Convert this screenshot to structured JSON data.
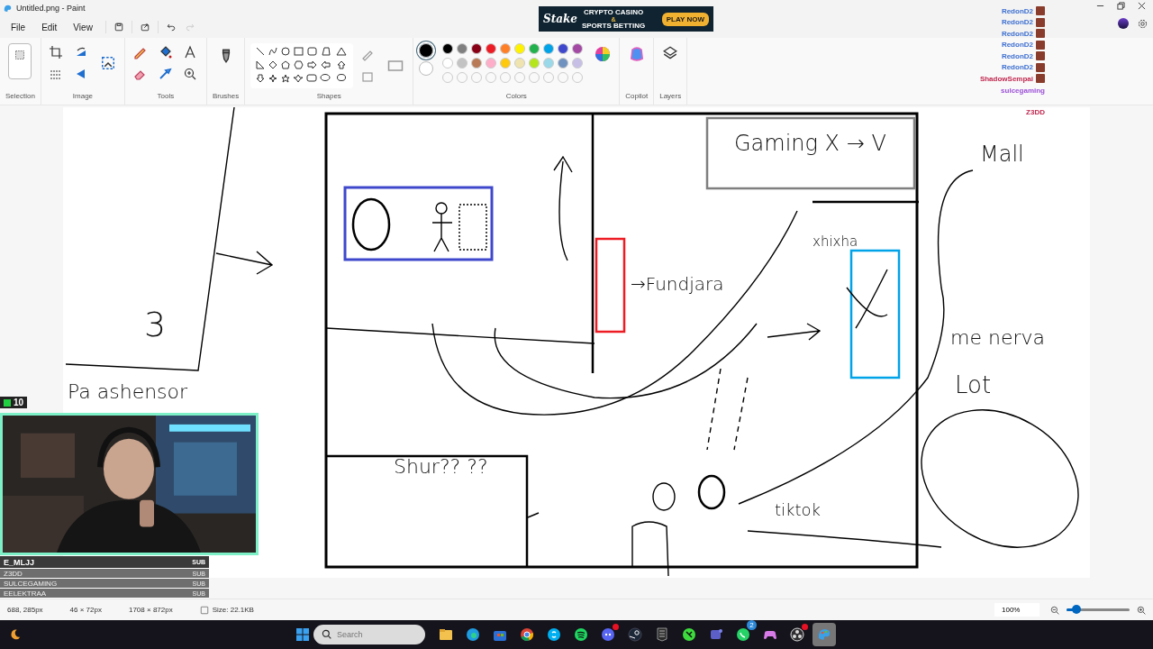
{
  "window": {
    "title": "Untitled.png - Paint"
  },
  "menu": [
    {
      "label": "File"
    },
    {
      "label": "Edit"
    },
    {
      "label": "View"
    }
  ],
  "redo": {
    "disabled": true
  },
  "ad": {
    "logo": "Stake",
    "line_1": "CRYPTO CASINO",
    "connector": "&",
    "line_2": "SPORTS BETTING",
    "button": "PLAY NOW"
  },
  "ribbon": {
    "groups": [
      {
        "label": "Selection"
      },
      {
        "label": "Image"
      },
      {
        "label": "Tools"
      },
      {
        "label": "Brushes"
      },
      {
        "label": "Shapes"
      },
      {
        "label": "Colors"
      },
      {
        "label": "Copilot"
      },
      {
        "label": "Layers"
      }
    ]
  },
  "colors": {
    "current": [
      {
        "color": "#000000",
        "selected": true
      },
      {
        "color": "#ffffff",
        "selected": false
      }
    ],
    "palette": [
      {
        "kind": "swatch",
        "color": "#000000"
      },
      {
        "kind": "swatch",
        "color": "#7f7f7f"
      },
      {
        "kind": "swatch",
        "color": "#880015"
      },
      {
        "kind": "swatch",
        "color": "#ed1c24"
      },
      {
        "kind": "swatch",
        "color": "#ff7f27"
      },
      {
        "kind": "swatch",
        "color": "#fff200"
      },
      {
        "kind": "swatch",
        "color": "#22b14c"
      },
      {
        "kind": "swatch",
        "color": "#00a2e8"
      },
      {
        "kind": "swatch",
        "color": "#3f48cc"
      },
      {
        "kind": "swatch",
        "color": "#a349a4"
      },
      {
        "kind": "swatch",
        "color": "#ffffff"
      },
      {
        "kind": "swatch",
        "color": "#c3c3c3"
      },
      {
        "kind": "swatch",
        "color": "#b97a57"
      },
      {
        "kind": "swatch",
        "color": "#ffaec9"
      },
      {
        "kind": "swatch",
        "color": "#ffc90e"
      },
      {
        "kind": "swatch",
        "color": "#efe4b0"
      },
      {
        "kind": "swatch",
        "color": "#b5e61d"
      },
      {
        "kind": "swatch",
        "color": "#99d9ea"
      },
      {
        "kind": "swatch",
        "color": "#7092be"
      },
      {
        "kind": "swatch",
        "color": "#c8bfe7"
      },
      {
        "kind": "empty"
      },
      {
        "kind": "empty"
      },
      {
        "kind": "empty"
      },
      {
        "kind": "empty"
      },
      {
        "kind": "empty"
      },
      {
        "kind": "empty"
      },
      {
        "kind": "empty"
      },
      {
        "kind": "empty"
      },
      {
        "kind": "empty"
      },
      {
        "kind": "empty"
      }
    ]
  },
  "chat": [
    {
      "name": "RedonD2",
      "color": "#3d6fd1"
    },
    {
      "name": "RedonD2",
      "color": "#3d6fd1"
    },
    {
      "name": "RedonD2",
      "color": "#3d6fd1"
    },
    {
      "name": "RedonD2",
      "color": "#3d6fd1"
    },
    {
      "name": "RedonD2",
      "color": "#3d6fd1"
    },
    {
      "name": "RedonD2",
      "color": "#3d6fd1"
    },
    {
      "name": "ShadowSempai",
      "color": "#c0264e"
    },
    {
      "name": "sulcegaming",
      "color": "#9b4fd6"
    },
    {
      "name": "Z3DD",
      "color": "#c0264e"
    }
  ],
  "canvas": {
    "notes": [
      {
        "text": "Gaming X → V"
      },
      {
        "text": "Mall"
      },
      {
        "text": "me nerva"
      },
      {
        "text": "Lot"
      },
      {
        "text": "tiktok"
      },
      {
        "text": "Shur?? ??"
      },
      {
        "text": "Pa ashensor"
      },
      {
        "text": "3"
      },
      {
        "text": "→Fundjara"
      },
      {
        "text": "xhixha"
      }
    ]
  },
  "webcam": {
    "kind": "picture",
    "viewer_count": "10"
  },
  "subscribers": [
    {
      "name": "E_MLJJ",
      "badge": "SUB",
      "faded": false
    },
    {
      "name": "Z3DD",
      "badge": "SUB",
      "faded": true
    },
    {
      "name": "SULCEGAMING",
      "badge": "SUB",
      "faded": true
    },
    {
      "name": "EELEKTRAA",
      "badge": "SUB",
      "faded": true
    }
  ],
  "status_bar": {
    "cursor": "688, 285px",
    "selection": "46 × 72px",
    "canvas_size": "1708 × 872px",
    "file_size": "Size: 22.1KB",
    "zoom": "100%",
    "zoom_slider": {
      "level": 0.15
    }
  },
  "taskbar": {
    "search": {
      "placeholder": "Search"
    },
    "apps": [
      {
        "kind": "folder",
        "selected": false
      },
      {
        "kind": "edge",
        "selected": false
      },
      {
        "kind": "store",
        "selected": false
      },
      {
        "kind": "chrome",
        "selected": false
      },
      {
        "kind": "skype",
        "selected": false
      },
      {
        "kind": "spotify",
        "selected": false
      },
      {
        "kind": "discord",
        "selected": false,
        "notification": true
      },
      {
        "kind": "steam",
        "selected": false
      },
      {
        "kind": "epic",
        "selected": false
      },
      {
        "kind": "green",
        "selected": false
      },
      {
        "kind": "teams",
        "selected": false
      },
      {
        "kind": "whatsapp",
        "selected": false,
        "badge": "2"
      },
      {
        "kind": "gamepad",
        "selected": false
      },
      {
        "kind": "obs",
        "selected": false,
        "notification": true
      },
      {
        "kind": "paint",
        "selected": true
      }
    ]
  }
}
